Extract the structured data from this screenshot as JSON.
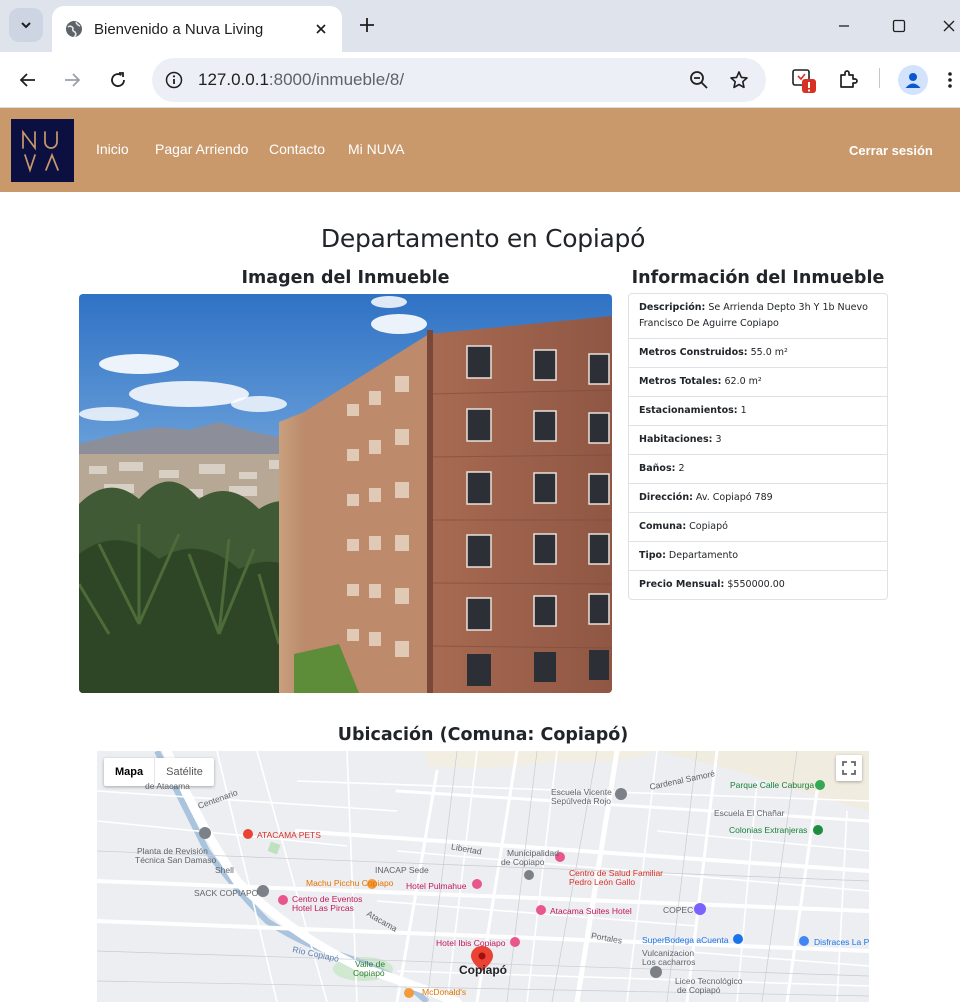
{
  "browser": {
    "tab_title": "Bienvenido a Nuva Living",
    "url_host": "127.0.0.1",
    "url_rest": ":8000/inmueble/8/"
  },
  "navbar": {
    "logo_text": "NUVA",
    "links": [
      "Inicio",
      "Pagar Arriendo",
      "Contacto",
      "Mi NUVA"
    ],
    "logout": "Cerrar sesión",
    "bg_color": "#c9986b",
    "logo_bg": "#0c1040"
  },
  "page": {
    "title": "Departamento en Copiapó",
    "image_heading": "Imagen del Inmueble",
    "info_heading": "Información del Inmueble",
    "map_heading": "Ubicación (Comuna: Copiapó)"
  },
  "info": [
    {
      "label": "Descripción:",
      "value": "Se Arrienda Depto 3h Y 1b Nuevo Francisco De Aguirre Copiapo"
    },
    {
      "label": "Metros Construidos:",
      "value": "55.0 m²"
    },
    {
      "label": "Metros Totales:",
      "value": "62.0 m²"
    },
    {
      "label": "Estacionamientos:",
      "value": "1"
    },
    {
      "label": "Habitaciones:",
      "value": "3"
    },
    {
      "label": "Baños:",
      "value": "2"
    },
    {
      "label": "Dirección:",
      "value": "Av. Copiapó 789"
    },
    {
      "label": "Comuna:",
      "value": "Copiapó"
    },
    {
      "label": "Tipo:",
      "value": "Departamento"
    },
    {
      "label": "Precio Mensual:",
      "value": "$550000.00"
    }
  ],
  "map": {
    "type_buttons": [
      "Mapa",
      "Satélite"
    ],
    "city": "Copiapó",
    "labels": {
      "l1": "de Atacama",
      "l2": "Centenario",
      "l3": "Planta de Revisión",
      "l4": "Técnica San Damaso",
      "l5": "Shell",
      "l6": "SACK COPIAPO",
      "l7": "INACAP Sede",
      "l8": "Municipalidad",
      "l9": "de Copiapo",
      "l10": "Escuela Vicente",
      "l11": "Sepúlveda Rojo",
      "l12": "Cardenal Samoré",
      "l13": "Escuela El Chañar",
      "l14": "COPEC",
      "l15": "Vulcanizacion",
      "l16": "Los cacharros",
      "l17": "Liceo Tecnológico",
      "l18": "de Copiapó",
      "l19": "Valle de",
      "l20": "Copiapó",
      "l21": "Río Copiapó",
      "l22": "Libertad",
      "l23": "Atacama",
      "l24": "Portales"
    },
    "pois": {
      "p1": "ATACAMA PETS",
      "p2": "Machu Picchu Copiapo",
      "p3": "Centro de Eventos",
      "p4": "Hotel Las Pircas",
      "p5": "Hotel Pulmahue",
      "p6": "Centro de Salud Familiar",
      "p7": "Pedro León Gallo",
      "p8": "Atacama Suites Hotel",
      "p9": "Hotel Ibis Copiapo",
      "p10": "McDonald's",
      "p11": "Parque Calle Caburga",
      "p12": "Colonias Extranjeras",
      "p13": "SuperBodega aCuenta",
      "p14": "Disfraces La P"
    }
  }
}
